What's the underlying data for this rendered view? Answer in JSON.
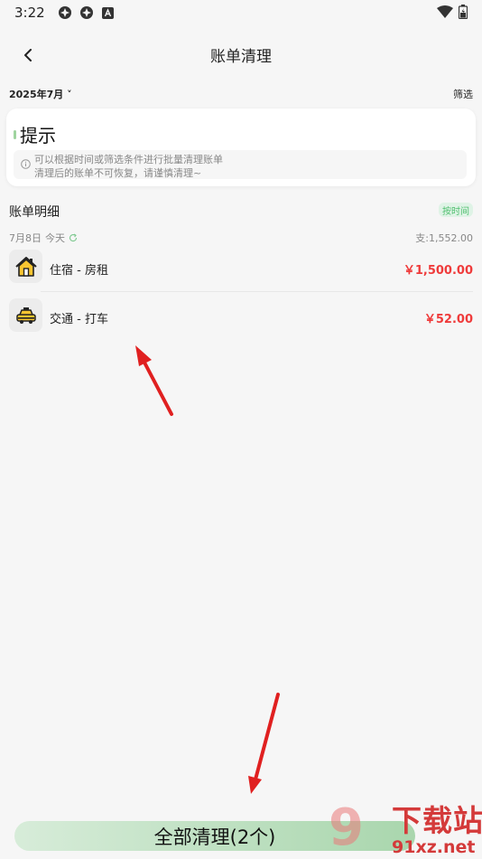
{
  "status_bar": {
    "time": "3:22"
  },
  "header": {
    "title": "账单清理"
  },
  "filter": {
    "month": "2025年7月",
    "filter_label": "筛选"
  },
  "tip": {
    "title": "提示",
    "line1": "可以根据时间或筛选条件进行批量清理账单",
    "line2": "清理后的账单不可恢复，请谨慎清理~"
  },
  "details": {
    "title": "账单明细",
    "sort_label": "按时间",
    "date": "7月8日",
    "weekday": "今天",
    "total": "支:1,552.00"
  },
  "bills": [
    {
      "name": "住宿 - 房租",
      "amount": "￥1,500.00",
      "icon": "house-icon"
    },
    {
      "name": "交通 - 打车",
      "amount": "￥52.00",
      "icon": "taxi-icon"
    }
  ],
  "clear_button": {
    "label": "全部清理(2个)"
  },
  "watermark": {
    "brand": "下载站",
    "url": "91xz.net"
  },
  "colors": {
    "accent_green": "#4fbf6e",
    "amount_red": "#ef3b3b",
    "button_green": "#a9d6ad",
    "arrow_red": "#e02020"
  }
}
